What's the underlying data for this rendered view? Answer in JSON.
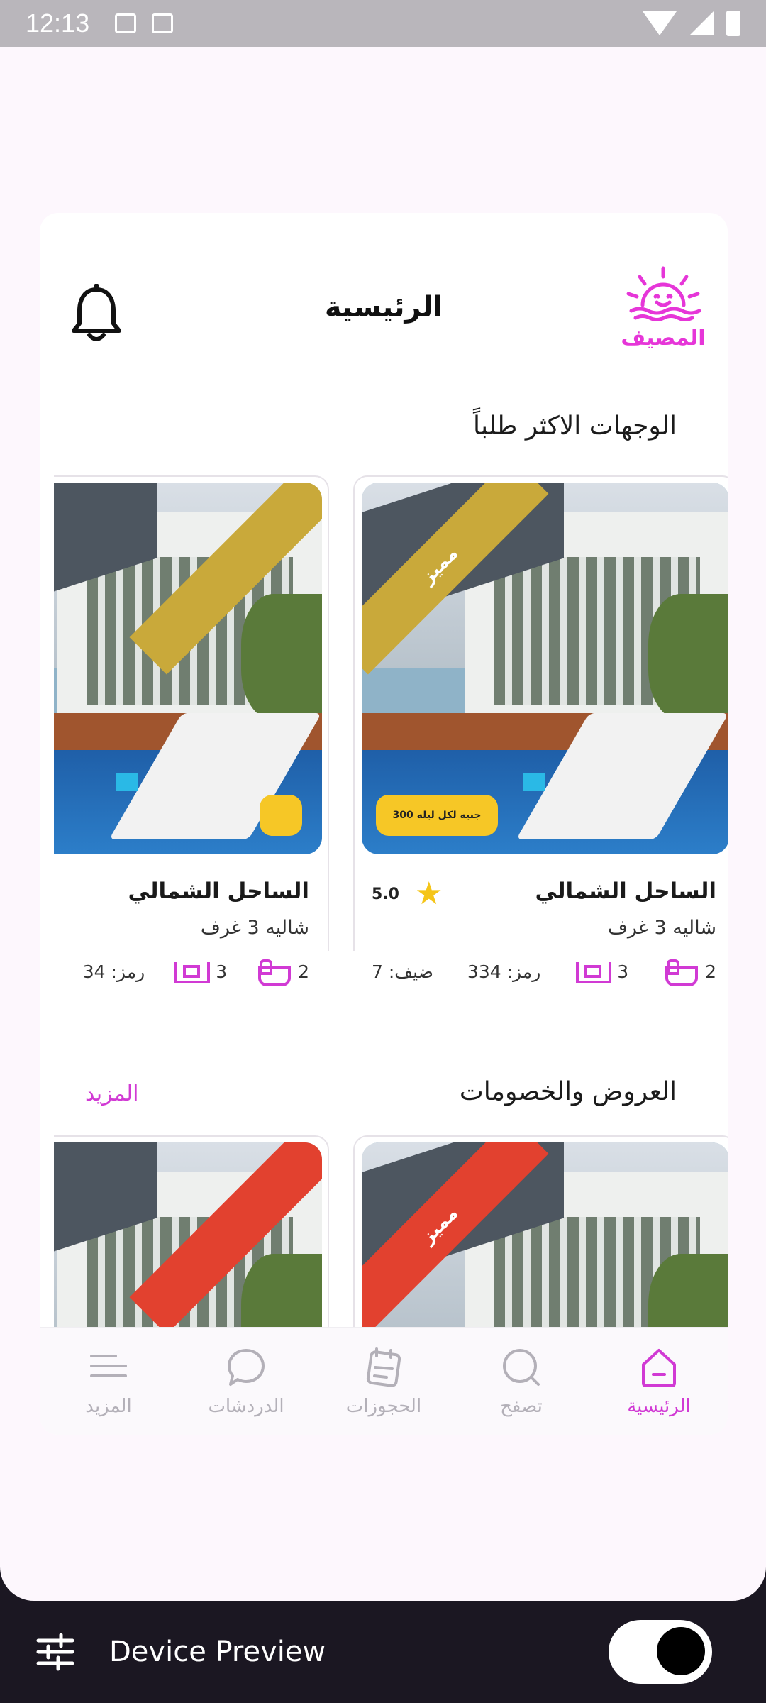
{
  "status_bar": {
    "time": "12:13"
  },
  "header": {
    "title": "الرئيسية",
    "logo_text": "المصيف"
  },
  "sections": {
    "popular": {
      "title": "الوجهات الاكثر طلباً",
      "cards": [
        {
          "badge": "مميز",
          "price": "300 جنيه لكل ليله",
          "title": "الساحل الشمالي",
          "rating": "5.0",
          "subtitle": "شاليه 3 غرف",
          "bathrooms": "2",
          "bedrooms": "3",
          "code": "رمز: 334",
          "guests": "ضيف: 7"
        },
        {
          "title": "الساحل الشمالي",
          "subtitle": "شاليه 3 غرف",
          "bathrooms": "2",
          "bedrooms": "3",
          "code": "رمز: 34"
        }
      ]
    },
    "offers": {
      "title": "العروض والخصومات",
      "more": "المزيد",
      "cards": [
        {
          "badge": "مميز"
        },
        {
          "badge": ""
        }
      ]
    }
  },
  "bottom_nav": [
    {
      "label": "الرئيسية",
      "icon": "home-icon",
      "active": true
    },
    {
      "label": "تصفح",
      "icon": "search-icon",
      "active": false
    },
    {
      "label": "الحجوزات",
      "icon": "bookings-icon",
      "active": false
    },
    {
      "label": "الدردشات",
      "icon": "chat-icon",
      "active": false
    },
    {
      "label": "المزيد",
      "icon": "menu-icon",
      "active": false
    }
  ],
  "device_preview": {
    "label": "Device Preview",
    "toggle_on": true
  },
  "colors": {
    "accent": "#d13ad4",
    "gold": "#c9a93a",
    "red": "#e2412f",
    "price_badge": "#f6c726"
  }
}
